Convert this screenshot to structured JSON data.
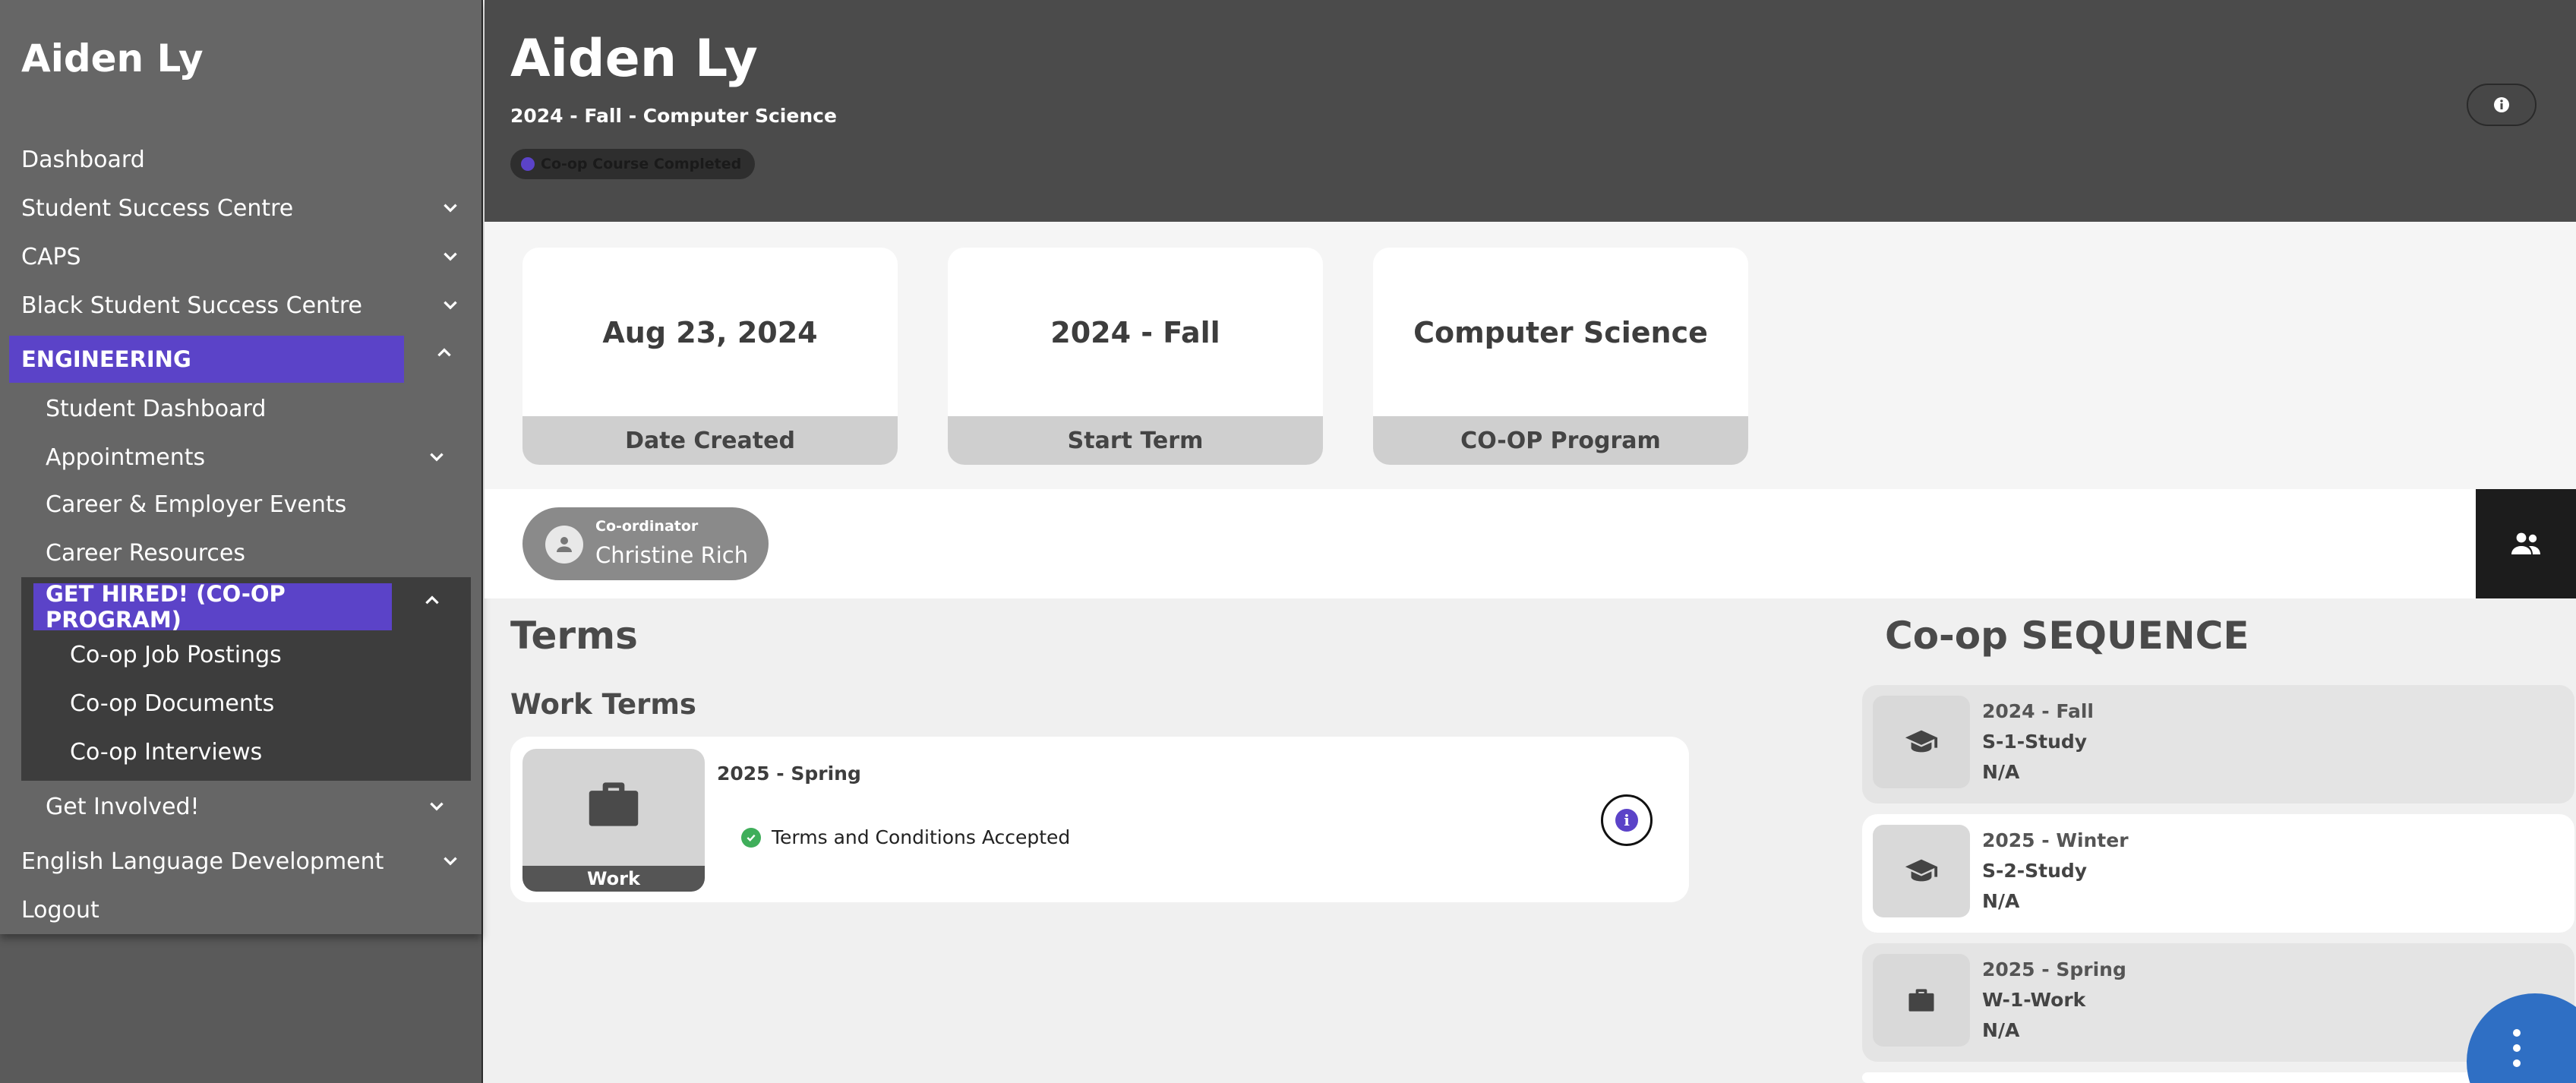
{
  "sidebar": {
    "title": "Aiden Ly",
    "items": [
      {
        "label": "Dashboard"
      },
      {
        "label": "Student Success Centre"
      },
      {
        "label": "CAPS"
      },
      {
        "label": "Black Student Success Centre"
      },
      {
        "label": "ENGINEERING"
      },
      {
        "label": "Student Dashboard"
      },
      {
        "label": "Appointments"
      },
      {
        "label": "Career & Employer Events"
      },
      {
        "label": "Career Resources"
      },
      {
        "label": "GET HIRED! (CO-OP PROGRAM)"
      },
      {
        "label": "Co-op Job Postings"
      },
      {
        "label": "Co-op Documents"
      },
      {
        "label": "Co-op Interviews"
      },
      {
        "label": "Get Involved!"
      },
      {
        "label": "English Language Development"
      },
      {
        "label": "Logout"
      }
    ],
    "highlight_color": "#5b43c8"
  },
  "header": {
    "name": "Aiden Ly",
    "subtitle": "2024 - Fall - Computer Science",
    "badge": "Co-op Course Completed"
  },
  "stats": [
    {
      "value": "Aug 23, 2024",
      "label": "Date Created"
    },
    {
      "value": "2024 - Fall",
      "label": "Start Term"
    },
    {
      "value": "Computer Science",
      "label": "CO-OP Program"
    }
  ],
  "coordinator": {
    "role": "Co-ordinator",
    "name": "Christine Rich"
  },
  "terms": {
    "title": "Terms",
    "work_terms_title": "Work Terms",
    "cards": [
      {
        "term": "2025 - Spring",
        "type": "Work",
        "status": "Terms and Conditions Accepted"
      }
    ]
  },
  "sequence": {
    "title": "Co-op SEQUENCE",
    "items": [
      {
        "term": "2024 - Fall",
        "code": "S-1-Study",
        "status": "N/A",
        "icon": "graduation-cap-icon"
      },
      {
        "term": "2025 - Winter",
        "code": "S-2-Study",
        "status": "N/A",
        "icon": "graduation-cap-icon"
      },
      {
        "term": "2025 - Spring",
        "code": "W-1-Work",
        "status": "N/A",
        "icon": "briefcase-icon"
      }
    ]
  },
  "colors": {
    "accent": "#5b43c8",
    "success": "#3fae5a",
    "fab": "#2f6fc4"
  }
}
